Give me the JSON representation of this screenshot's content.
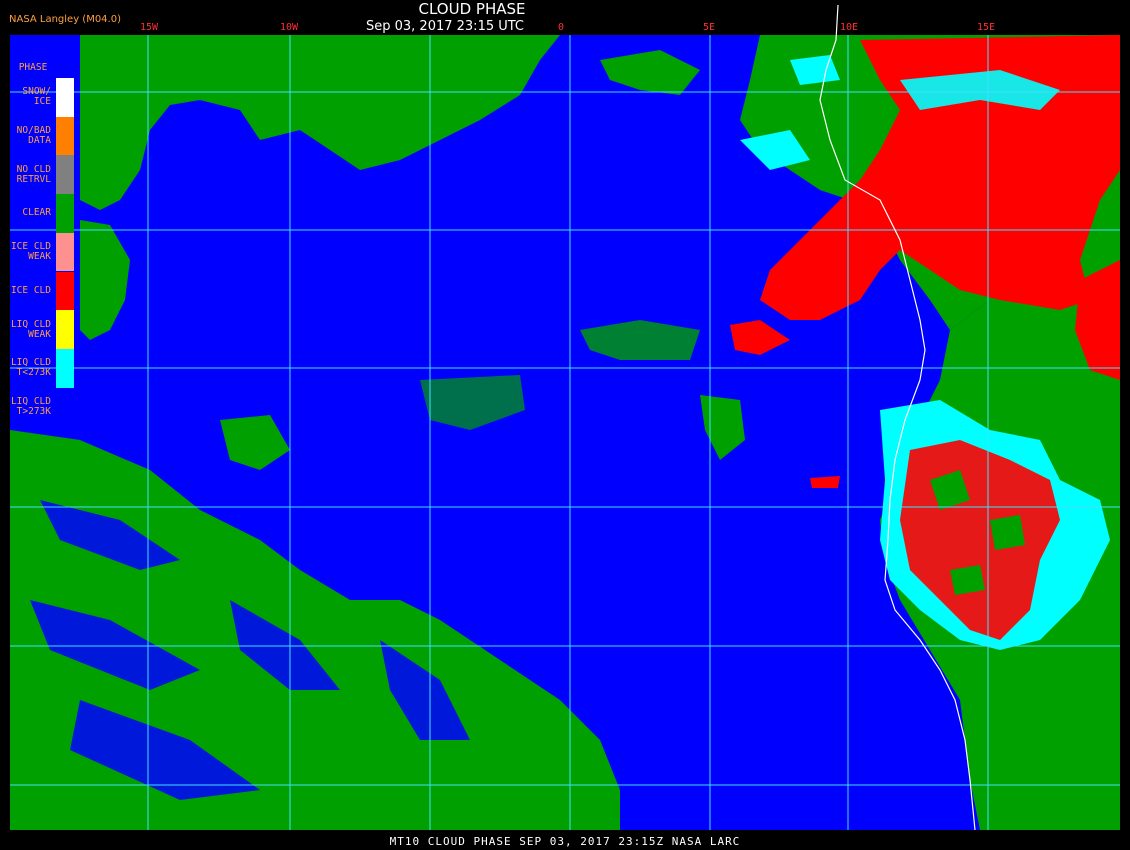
{
  "header": {
    "title": "CLOUD PHASE",
    "datetime": "Sep 03, 2017 23:15 UTC",
    "producer": "NASA Langley (M04.0)"
  },
  "footer": {
    "text": "MT10  CLOUD PHASE   SEP 03, 2017 23:15Z   NASA LARC"
  },
  "longitude_labels": [
    "15W",
    "10W",
    "0",
    "5E",
    "10E",
    "15E"
  ],
  "legend": {
    "title": "PHASE",
    "items": [
      {
        "label": "SNOW/\nICE",
        "color": "#ffffff"
      },
      {
        "label": "NO/BAD\nDATA",
        "color": "#ff8000"
      },
      {
        "label": "NO CLD\nRETRVL",
        "color": "#808080"
      },
      {
        "label": "CLEAR",
        "color": "#00a000"
      },
      {
        "label": "ICE CLD\nWEAK",
        "color": "#ff9090"
      },
      {
        "label": "ICE CLD",
        "color": "#ff0000"
      },
      {
        "label": "LIQ CLD\nWEAK",
        "color": "#ffff00"
      },
      {
        "label": "LIQ CLD\nT<273K",
        "color": "#00ffff"
      },
      {
        "label": "LIQ CLD\nT>273K",
        "color": "#0000ff"
      }
    ]
  },
  "colors": {
    "ocean_liq_cloud": "#0000ff",
    "clear": "#00a000",
    "ice_cloud": "#ff0000",
    "cold_liq_cloud": "#00ffff",
    "gridlines": "#40e0ff",
    "coastline": "#ffffff"
  }
}
